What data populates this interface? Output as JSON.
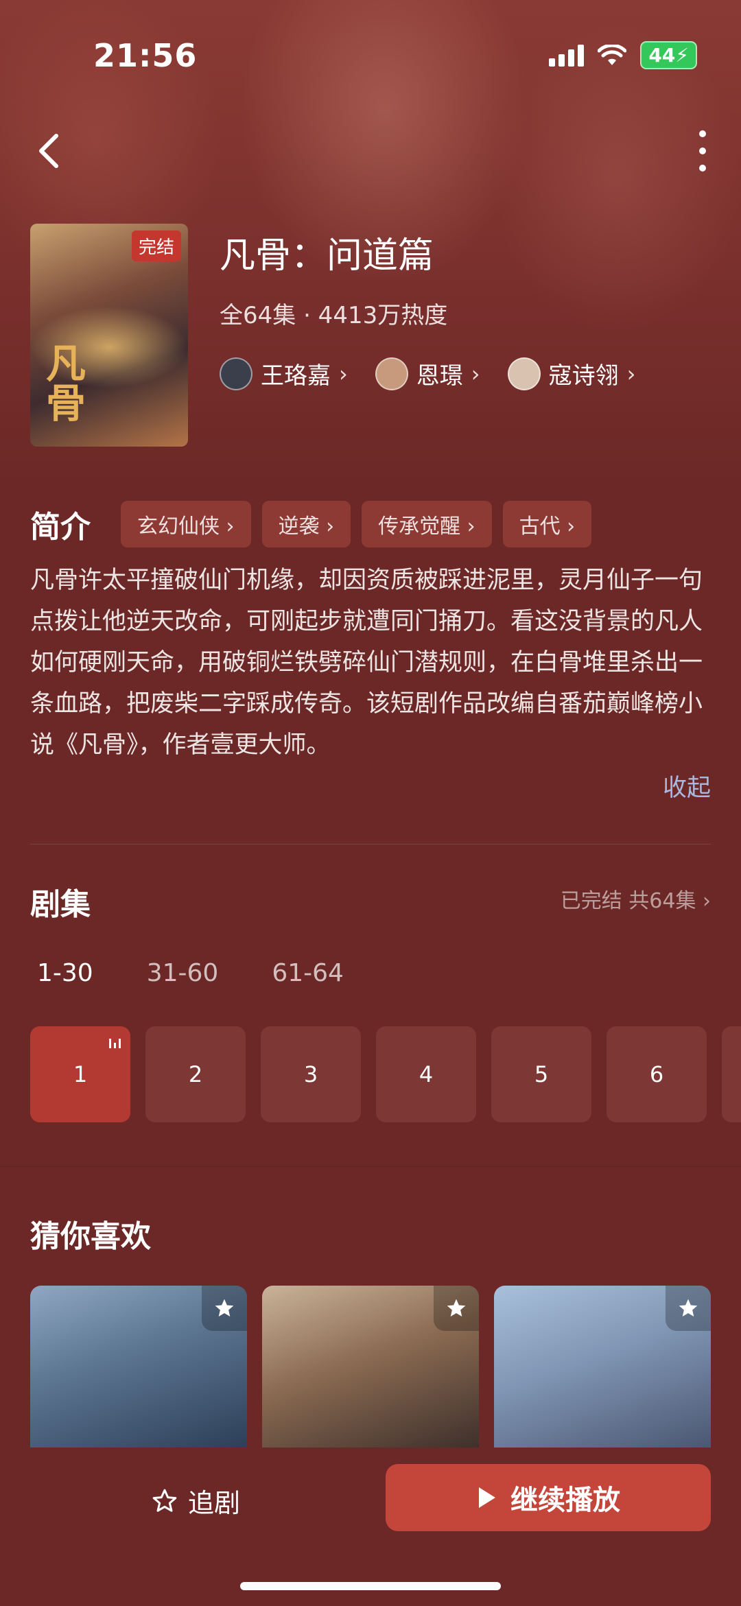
{
  "status_bar": {
    "time": "21:56",
    "battery": "44"
  },
  "header": {
    "back_icon": "chevron-left-icon",
    "more_icon": "more-vertical-icon"
  },
  "drama": {
    "title": "凡骨：问道篇",
    "badge": "完结",
    "poster_text": "凡骨",
    "meta": "全64集 · 4413万热度",
    "cast": [
      {
        "name": "王珞嘉",
        "avatar_color": "#3a3f4b"
      },
      {
        "name": "恩璟",
        "avatar_color": "#c79a7e"
      },
      {
        "name": "寇诗翎",
        "avatar_color": "#d9c3b0"
      }
    ]
  },
  "intro": {
    "label": "简介",
    "tags": [
      "玄幻仙侠",
      "逆袭",
      "传承觉醒",
      "古代"
    ],
    "text": "凡骨许太平撞破仙门机缘，却因资质被踩进泥里，灵月仙子一句点拨让他逆天改命，可刚起步就遭同门捅刀。看这没背景的凡人如何硬刚天命，用破铜烂铁劈碎仙门潜规则，在白骨堆里杀出一条血路，把废柴二字踩成传奇。该短剧作品改编自番茄巅峰榜小说《凡骨》，作者壹更大师。",
    "collapse": "收起"
  },
  "episodes": {
    "label": "剧集",
    "status": "已完结 共64集",
    "ranges": [
      "1-30",
      "31-60",
      "61-64"
    ],
    "active_range": 0,
    "items": [
      "1",
      "2",
      "3",
      "4",
      "5",
      "6"
    ],
    "playing": 0
  },
  "recommend": {
    "label": "猜你喜欢",
    "star_icon": "star-icon"
  },
  "bottom_bar": {
    "follow_label": "追剧",
    "play_label": "继续播放"
  },
  "colors": {
    "accent": "#c44539",
    "background": "#6b2826",
    "tag": "#8e3a34",
    "link": "#a8b8e0"
  }
}
